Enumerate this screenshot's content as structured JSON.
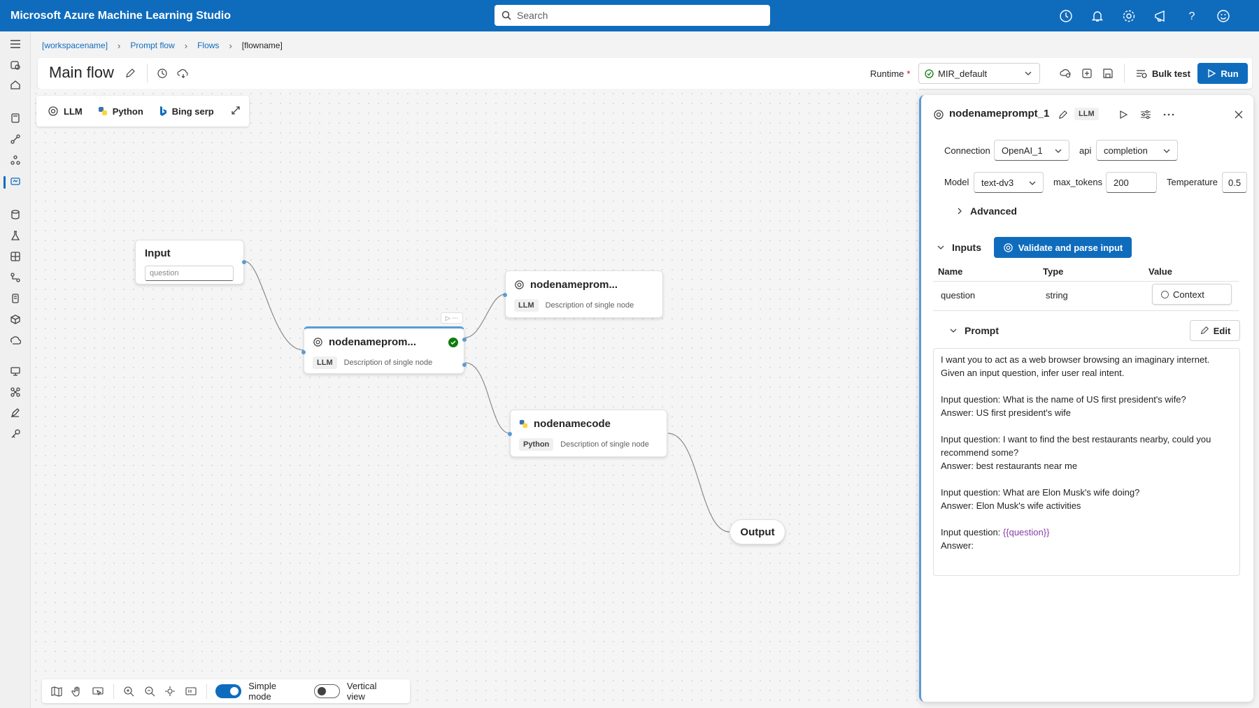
{
  "app": {
    "title": "Microsoft Azure Machine Learning Studio",
    "search_placeholder": "Search"
  },
  "topbar_icons": [
    "history-icon",
    "bell-icon",
    "gear-icon",
    "megaphone-icon",
    "help-icon",
    "smiley-icon"
  ],
  "breadcrumb": [
    "[workspacename]",
    "Prompt flow",
    "Flows",
    "[flowname]"
  ],
  "header": {
    "title": "Main flow",
    "runtime_label": "Runtime",
    "runtime_required": "*",
    "runtime_value": "MIR_default",
    "bulk_test": "Bulk test",
    "run": "Run"
  },
  "toolbox": {
    "llm": "LLM",
    "python": "Python",
    "bing": "Bing serp"
  },
  "canvas": {
    "input_node": {
      "title": "Input",
      "placeholder": "question"
    },
    "llm_main": {
      "title": "nodenameprom...",
      "badge": "LLM",
      "desc": "Description of single node"
    },
    "llm_top": {
      "title": "nodenameprom...",
      "badge": "LLM",
      "desc": "Description of single node"
    },
    "code_node": {
      "title": "nodenamecode",
      "badge": "Python",
      "desc": "Description of single node"
    },
    "output_node": {
      "title": "Output"
    },
    "mini_controls": "▷ ⋯"
  },
  "bottombar": {
    "simple_mode": "Simple mode",
    "vertical_view": "Vertical view",
    "simple_on": true,
    "vertical_on": false
  },
  "panel": {
    "title": "nodenameprompt_1",
    "badge": "LLM",
    "connection_label": "Connection",
    "connection_value": "OpenAI_1",
    "api_label": "api",
    "api_value": "completion",
    "model_label": "Model",
    "model_value": "text-dv3",
    "max_tokens_label": "max_tokens",
    "max_tokens_value": "200",
    "temperature_label": "Temperature",
    "temperature_value": "0.5",
    "advanced": "Advanced",
    "inputs": "Inputs",
    "validate": "Validate and parse input",
    "columns": {
      "name": "Name",
      "type": "Type",
      "value": "Value"
    },
    "row": {
      "name": "question",
      "type": "string",
      "value": "Context"
    },
    "prompt": "Prompt",
    "edit": "Edit",
    "prompt_lines": [
      "I want you to act as a web browser browsing an imaginary internet.",
      "Given an input question, infer user real intent.",
      "",
      "Input question: What is the name of US first president's wife?",
      "Answer: US first president's wife",
      "",
      "Input question: I want to find the best restaurants nearby, could you",
      "recommend some?",
      "Answer: best restaurants near me",
      "",
      "Input question: What are Elon Musk's wife doing?",
      "Answer: Elon Musk's wife activities",
      "",
      "Input question: ",
      "Answer:"
    ],
    "prompt_variable": "{{question}}"
  },
  "colors": {
    "brand": "#0f6cbd",
    "success": "#107c10",
    "variable": "#8a3ca6"
  }
}
